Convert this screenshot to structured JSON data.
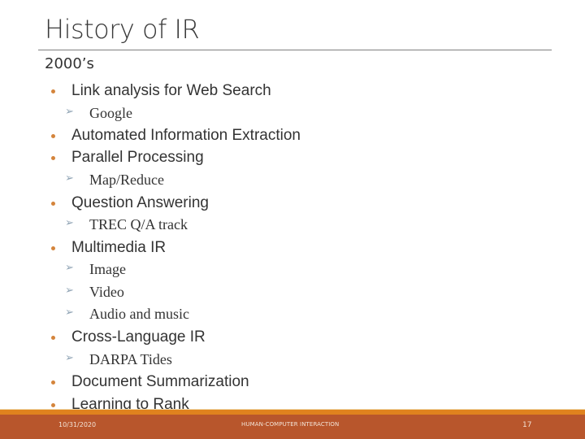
{
  "slide": {
    "title": "History of IR",
    "subheading": "2000’s",
    "bullet_icon": "orange-dot",
    "sub_bullet_icon": "arrowhead-right",
    "colors": {
      "accent_orange": "#e0821e",
      "footer_rust": "#b8562c",
      "bullet_orange": "#d4843c",
      "arrow_bluegray": "#8fa3b4",
      "text": "#333333"
    },
    "items": [
      {
        "level": 1,
        "text": "Link analysis for Web Search"
      },
      {
        "level": 2,
        "text": "Google"
      },
      {
        "level": 1,
        "text": "Automated Information Extraction"
      },
      {
        "level": 1,
        "text": "Parallel Processing"
      },
      {
        "level": 2,
        "text": "Map/Reduce"
      },
      {
        "level": 1,
        "text": "Question Answering"
      },
      {
        "level": 2,
        "text": "TREC Q/A track"
      },
      {
        "level": 1,
        "text": "Multimedia IR"
      },
      {
        "level": 2,
        "text": "Image"
      },
      {
        "level": 2,
        "text": "Video"
      },
      {
        "level": 2,
        "text": "Audio and music"
      },
      {
        "level": 1,
        "text": "Cross-Language IR"
      },
      {
        "level": 2,
        "text": "DARPA Tides"
      },
      {
        "level": 1,
        "text": "Document Summarization"
      },
      {
        "level": 1,
        "text": "Learning to Rank"
      }
    ]
  },
  "footer": {
    "date": "10/31/2020",
    "course": "HUMAN-COMPUTER INTERACTION",
    "page_number": "17"
  }
}
